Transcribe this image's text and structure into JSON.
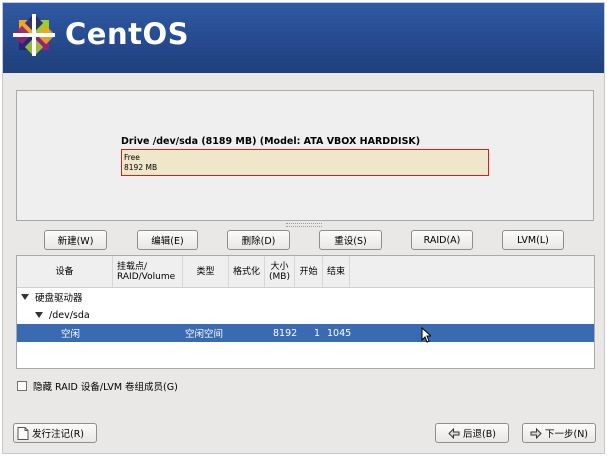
{
  "banner": {
    "brand": "CentOS",
    "brand_icon": "centos-logo-icon"
  },
  "disk": {
    "title": "Drive /dev/sda (8189 MB) (Model: ATA VBOX HARDDISK)",
    "free_label": "Free",
    "free_size": "8192 MB"
  },
  "toolbar": {
    "new": "新建(W)",
    "edit": "编辑(E)",
    "delete": "删除(D)",
    "reset": "重设(S)",
    "raid": "RAID(A)",
    "lvm": "LVM(L)"
  },
  "table": {
    "headers": [
      "设备",
      "挂载点/\nRAID/Volume",
      "类型",
      "格式化",
      "大小\n(MB)",
      "开始",
      "结束"
    ],
    "rows": [
      {
        "device": "硬盘驱动器"
      },
      {
        "device": "/dev/sda"
      },
      {
        "device": "空闲",
        "mount": "",
        "type": "空闲空间",
        "format": "",
        "size": "8192",
        "start": "1",
        "end": "1045"
      }
    ]
  },
  "hide_raid_label": "隐藏 RAID 设备/LVM 卷组成员(G)",
  "footer": {
    "release_notes": "发行注记(R)",
    "back": "后退(B)",
    "next": "下一步(N)"
  },
  "colors": {
    "banner": "#2f5aa3",
    "selection": "#3a6ab2",
    "free_fill": "#efe7c9",
    "free_border": "#d12020"
  }
}
